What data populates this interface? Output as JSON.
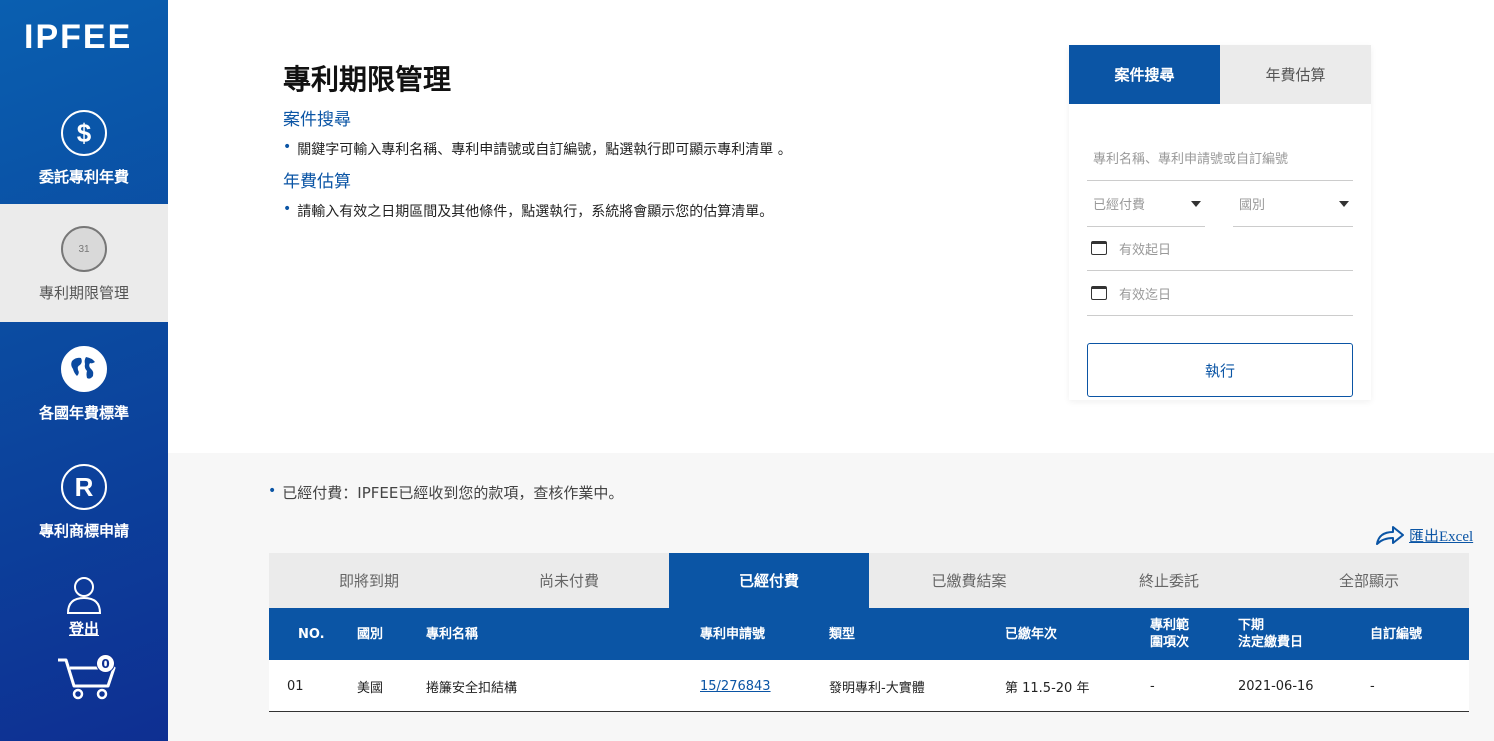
{
  "brand": {
    "logo": "IPFEE"
  },
  "sidebar": {
    "items": [
      {
        "label": "委託專利年費",
        "icon": "dollar-icon",
        "glyph": "$"
      },
      {
        "label": "專利期限管理",
        "icon": "calendar-icon",
        "glyph": "31"
      },
      {
        "label": "各國年費標準",
        "icon": "globe-icon",
        "glyph": ""
      },
      {
        "label": "專利商標申請",
        "icon": "registered-icon",
        "glyph": "R"
      }
    ],
    "logout_label": "登出",
    "cart_count": "0"
  },
  "intro": {
    "title": "專利期限管理",
    "sections": [
      {
        "heading": "案件搜尋",
        "text": "關鍵字可輸入專利名稱、專利申請號或自訂編號，點選執行即可顯示專利清單 。"
      },
      {
        "heading": "年費估算",
        "text": "請輸入有效之日期區間及其他條件，點選執行，系統將會顯示您的估算清單。"
      }
    ]
  },
  "panel": {
    "tabs": [
      "案件搜尋",
      "年費估算"
    ],
    "keyword_placeholder": "專利名稱、專利申請號或自訂編號",
    "status_select": "已經付費",
    "country_select": "國別",
    "start_date": "有效起日",
    "end_date": "有效迄日",
    "execute_label": "執行"
  },
  "results": {
    "note": "已經付費：IPFEE已經收到您的款項，查核作業中。",
    "export_label": "匯出Excel",
    "tabs": [
      "即將到期",
      "尚未付費",
      "已經付費",
      "已繳費結案",
      "終止委託",
      "全部顯示"
    ],
    "active_tab": "已經付費",
    "columns": {
      "no": "NO.",
      "country": "國別",
      "name": "專利名稱",
      "app_no": "專利申請號",
      "type": "類型",
      "paid_years": "已繳年次",
      "scope_1": "專利範",
      "scope_2": "圍項次",
      "due_1": "下期",
      "due_2": "法定繳費日",
      "custom": "自訂編號"
    },
    "rows": [
      {
        "no": "01",
        "country": "美國",
        "name": "捲簾安全扣結構",
        "app_no": "15/276843",
        "type": "發明專利-大實體",
        "paid_years": "第 11.5-20 年",
        "scope": "-",
        "due": "2021-06-16",
        "custom": "-"
      }
    ]
  },
  "colors": {
    "primary": "#0b55a5",
    "sidebar_dark": "#0e2f92",
    "active_nav_bg": "#ebebeb"
  }
}
